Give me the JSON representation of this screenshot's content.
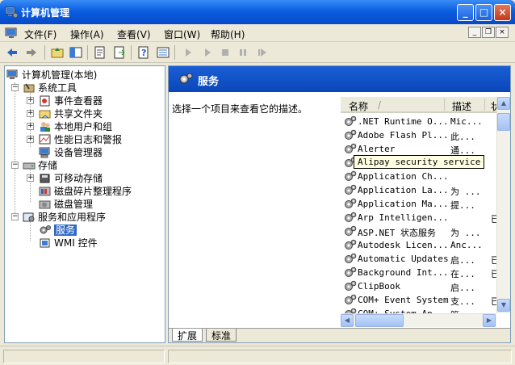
{
  "window": {
    "title": "计算机管理",
    "controls": {
      "minimize": "_",
      "maximize": "□",
      "close": "×"
    }
  },
  "menu": {
    "items": [
      "文件(F)",
      "操作(A)",
      "查看(V)",
      "窗口(W)",
      "帮助(H)"
    ],
    "mdi_controls": {
      "minimize": "_",
      "restore": "❐",
      "close": "×"
    }
  },
  "toolbar": {
    "icons": [
      "back-arrow-icon",
      "forward-arrow-icon",
      "up-folder-icon",
      "show-hide-tree-icon",
      "properties-icon",
      "export-list-icon",
      "help-icon",
      "view-icon",
      "play-icon",
      "play-alt-icon",
      "stop-icon",
      "pause-icon",
      "restart-icon"
    ]
  },
  "tree": {
    "root": "计算机管理(本地)",
    "nodes": [
      {
        "label": "系统工具",
        "level": 1,
        "expanded": true
      },
      {
        "label": "事件查看器",
        "level": 2,
        "expander": "+"
      },
      {
        "label": "共享文件夹",
        "level": 2,
        "expander": "+"
      },
      {
        "label": "本地用户和组",
        "level": 2,
        "expander": "+"
      },
      {
        "label": "性能日志和警报",
        "level": 2,
        "expander": "+"
      },
      {
        "label": "设备管理器",
        "level": 2,
        "expander": ""
      },
      {
        "label": "存储",
        "level": 1,
        "expanded": true
      },
      {
        "label": "可移动存储",
        "level": 2,
        "expander": "+"
      },
      {
        "label": "磁盘碎片整理程序",
        "level": 2,
        "expander": ""
      },
      {
        "label": "磁盘管理",
        "level": 2,
        "expander": ""
      },
      {
        "label": "服务和应用程序",
        "level": 1,
        "expanded": true
      },
      {
        "label": "服务",
        "level": 2,
        "expander": "",
        "selected": true
      },
      {
        "label": "WMI 控件",
        "level": 2,
        "expander": ""
      }
    ],
    "expander_minus": "−"
  },
  "right": {
    "header_title": "服务",
    "description_prompt": "选择一个项目来查看它的描述。",
    "columns": {
      "name": "名称",
      "sort_arrow": "/",
      "description": "描述",
      "status": "状"
    },
    "services": [
      {
        "name": ".NET Runtime O...",
        "desc": "Mic...",
        "status": ""
      },
      {
        "name": "Adobe Flash Pl...",
        "desc": "此...",
        "status": ""
      },
      {
        "name": "Alerter",
        "desc": "通...",
        "status": ""
      },
      {
        "name": "Alipay security service",
        "desc": "",
        "status": ""
      },
      {
        "name": "Application Ch...",
        "desc": "",
        "status": ""
      },
      {
        "name": "Application La...",
        "desc": "为 ...",
        "status": ""
      },
      {
        "name": "Application Ma...",
        "desc": "提...",
        "status": ""
      },
      {
        "name": "Arp Intelligen...",
        "desc": "",
        "status": "已"
      },
      {
        "name": "ASP.NET 状态服务",
        "desc": "为 ...",
        "status": ""
      },
      {
        "name": "Autodesk Licen...",
        "desc": "Anc...",
        "status": ""
      },
      {
        "name": "Automatic Updates",
        "desc": "启...",
        "status": "已"
      },
      {
        "name": "Background Int...",
        "desc": "在...",
        "status": "已"
      },
      {
        "name": "ClipBook",
        "desc": "启...",
        "status": ""
      },
      {
        "name": "COM+ Event System",
        "desc": "支...",
        "status": "已"
      },
      {
        "name": "COM+ System Ap...",
        "desc": "管...",
        "status": ""
      }
    ],
    "tooltip": "Alipay security service",
    "tabs": [
      "扩展",
      "标准"
    ],
    "scroll": {
      "up": "▲",
      "down": "▼",
      "left": "◀",
      "right": "▶"
    }
  },
  "colors": {
    "title_blue": "#0a5fe0",
    "selection": "#316ac5",
    "header_blue": "#0a46b8"
  }
}
